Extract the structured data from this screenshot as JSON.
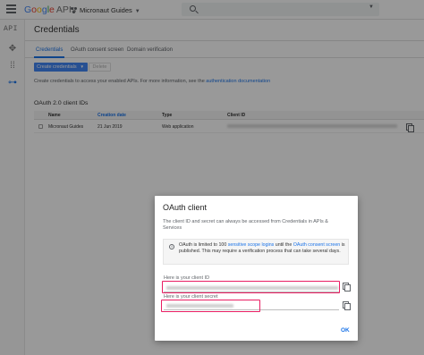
{
  "topbar": {
    "brand": [
      "G",
      "o",
      "o",
      "g",
      "l",
      "e"
    ],
    "brand_apis": "APIs",
    "project": "Micronaut Guides",
    "search_placeholder": ""
  },
  "leftnav": {
    "api_label": "API",
    "icons": [
      "dashboard-icon",
      "library-icon",
      "credentials-key-icon"
    ]
  },
  "page": {
    "title": "Credentials",
    "tabs": [
      {
        "label": "Credentials",
        "active": true
      },
      {
        "label": "OAuth consent screen",
        "active": false
      },
      {
        "label": "Domain verification",
        "active": false
      }
    ],
    "create_button": "Create credentials",
    "delete_button": "Delete",
    "info_text": "Create credentials to access your enabled APIs. For more information, see the ",
    "info_link": "authentication documentation",
    "section_title": "OAuth 2.0 client IDs",
    "columns": [
      "Name",
      "Creation date",
      "Type",
      "Client ID"
    ],
    "rows": [
      {
        "name": "Micronaut Guides",
        "created": "21 Jun 2019",
        "type": "Web application"
      }
    ]
  },
  "dialog": {
    "title": "OAuth client",
    "description": "The client ID and secret can always be accessed from Credentials in APIs & Services",
    "notice_pre": "OAuth is limited to 100 ",
    "notice_link1": "sensitive scope logins",
    "notice_mid": " until the ",
    "notice_link2": "OAuth consent screen",
    "notice_post": " is published. This may require a verification process that can take several days.",
    "client_id_label": "Here is your client ID",
    "client_secret_label": "Here is your client secret",
    "ok_label": "OK"
  },
  "colors": {
    "accent": "#1a73e8",
    "button": "#4285f4",
    "highlight": "#e91e63"
  }
}
